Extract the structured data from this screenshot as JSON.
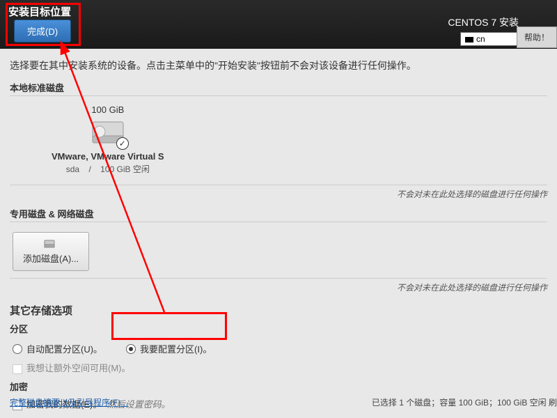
{
  "header": {
    "title": "安装目标位置",
    "right_title": "CENTOS 7 安装",
    "done_btn": "完成(D)",
    "lang": "cn",
    "help_btn": "帮助！"
  },
  "main": {
    "description": "选择要在其中安装系统的设备。点击主菜单中的\"开始安装\"按钮前不会对该设备进行任何操作。",
    "local_disks_label": "本地标准磁盘",
    "disk": {
      "size": "100 GiB",
      "name": "VMware, VMware Virtual S",
      "id": "sda",
      "sep": "/",
      "free": "100 GiB 空闲"
    },
    "not_listed_note": "不会对未在此处选择的磁盘进行任何操作",
    "special_net_label": "专用磁盘 & 网络磁盘",
    "add_disk_btn": "添加磁盘(A)...",
    "other_storage_title": "其它存储选项",
    "partition_label": "分区",
    "radio_auto": "自动配置分区(U)。",
    "radio_manual": "我要配置分区(I)。",
    "extra_space": "我想让额外空间可用(M)。",
    "encrypt_label": "加密",
    "encrypt_check": "加密我的数据(E)。",
    "encrypt_hint": "然后设置密码。",
    "footer_link": "完整磁盘摘要以及引导程序(F)...",
    "footer_status": "已选择 1 个磁盘；容量 100 GiB；100 GiB 空闲 刷"
  }
}
